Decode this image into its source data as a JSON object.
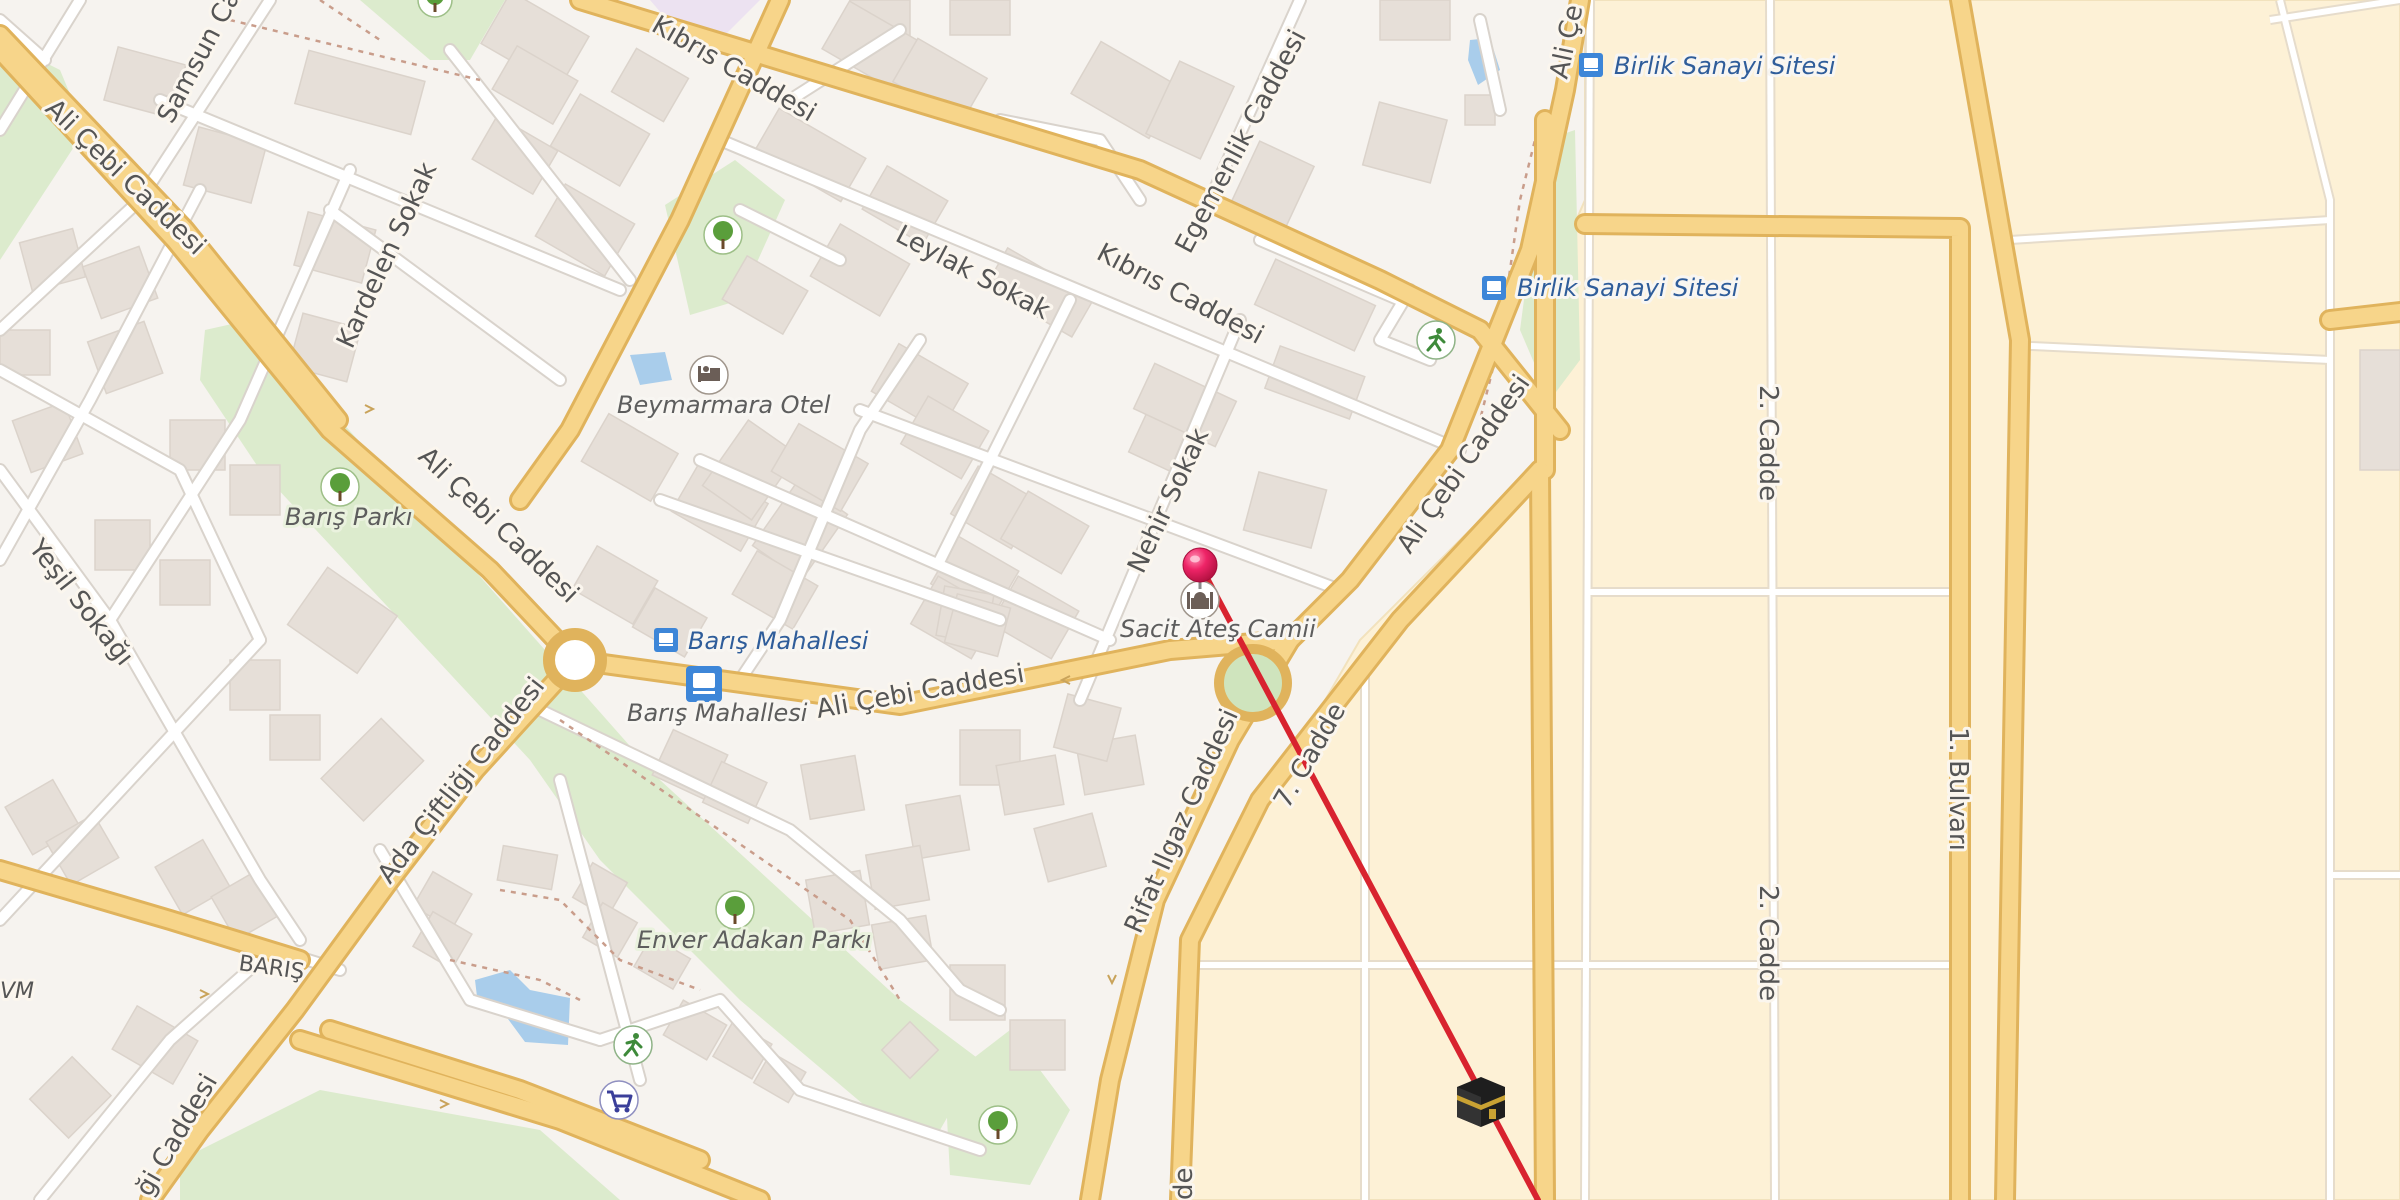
{
  "map": {
    "colors": {
      "background": "#f6f3ef",
      "building": "#e6dfd8",
      "park": "#dcebcd",
      "industrial": "#fdf1d6",
      "major_road": "#f7d58a",
      "minor_road": "#ffffff",
      "water": "#a9cdeb",
      "route_line": "#d8232f",
      "pin": "#e8185f",
      "bus_stop": "#3d86d8"
    },
    "streets": {
      "ali_cebi_1": "Ali Çebi Caddesi",
      "ali_cebi_2": "Ali Çebi Caddesi",
      "ali_cebi_3": "Ali Çebi Caddesi",
      "ali_cebi_4": "Ali Çebi Caddesi",
      "ali_cebi_5": "Ali Çe",
      "kibris_1": "Kıbrıs Caddesi",
      "kibris_2": "Kıbrıs Caddesi",
      "samsun": "Samsun Cad",
      "kardelen": "Kardelen Sokak",
      "leylak": "Leylak Sokak",
      "egemenlik": "Egemenlik Caddesi",
      "nehir": "Nehir Sokak",
      "yesil": "Yeşil Sokağı",
      "ada_ciftligi": "Ada Çiftliği Caddesi",
      "ada_ciftligi_2": "ği Caddesi",
      "rifat_ilgaz": "Rifat Ilgaz Caddesi",
      "yedi_cadde": "7. Cadde",
      "iki_cadde_1": "2. Cadde",
      "iki_cadde_2": "2. Cadde",
      "bir_bulvari": "1. Bulvarı",
      "baris": "BARIŞ",
      "avm_fragment": "VM",
      "cadde_fragment": "de"
    },
    "pois": {
      "beymarmara": "Beymarmara Otel",
      "baris_parki": "Barış Parkı",
      "enver_adakan": "Enver Adakan Parkı",
      "sacit_ates": "Sacit Ateş Camii"
    },
    "transit": {
      "birlik_1": "Birlik Sanayi Sitesi",
      "birlik_2": "Birlik Sanayi Sitesi",
      "baris_mah_1": "Barış Mahallesi",
      "baris_mah_2": "Barış Mahallesi"
    },
    "icons": [
      "tree-icon",
      "hotel-icon",
      "bus-stop-icon",
      "worship-icon",
      "fitness-icon",
      "shopping-cart-icon",
      "kaaba-icon",
      "location-pin-icon"
    ]
  }
}
